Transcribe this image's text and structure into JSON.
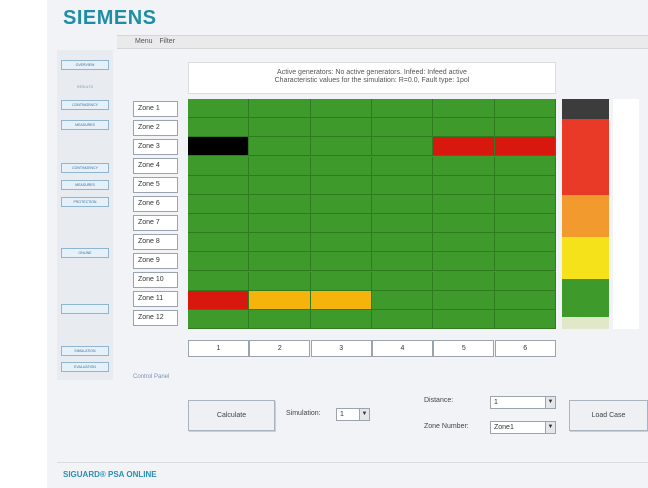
{
  "brand": {
    "logo": "SIEMENS",
    "footer": "SIGUARD® PSA ONLINE"
  },
  "menu": {
    "items": [
      "Menu",
      "Filter"
    ]
  },
  "sidebar": {
    "items": [
      {
        "label": "OVERVIEW",
        "kind": "button"
      },
      {
        "label": "RESULTS",
        "kind": "label"
      },
      {
        "label": "CONTINGENCY",
        "kind": "button"
      },
      {
        "label": "MEASURES",
        "kind": "button"
      },
      {
        "label": "",
        "kind": "label"
      },
      {
        "label": "CONTINGENCY",
        "kind": "button"
      },
      {
        "label": "MEASURES",
        "kind": "button"
      },
      {
        "label": "PROTECTION",
        "kind": "button"
      },
      {
        "label": "",
        "kind": "label"
      },
      {
        "label": "",
        "kind": "label"
      },
      {
        "label": "ONLINE",
        "kind": "button"
      },
      {
        "label": "",
        "kind": "label"
      },
      {
        "label": "",
        "kind": "label"
      },
      {
        "label": "",
        "kind": "label"
      },
      {
        "label": "",
        "kind": "button"
      },
      {
        "label": "",
        "kind": "label"
      },
      {
        "label": "SIMULATION",
        "kind": "button"
      },
      {
        "label": "EVALUATION",
        "kind": "button"
      }
    ]
  },
  "info": {
    "line1": "Active generators: No active generators.  Infeed: Infeed active",
    "line2": "Characteristic values for the simulation: R=0.0, Fault type: 1pol"
  },
  "zones": [
    "Zone 1",
    "Zone 2",
    "Zone 3",
    "Zone 4",
    "Zone 5",
    "Zone 6",
    "Zone 7",
    "Zone 8",
    "Zone 9",
    "Zone 10",
    "Zone 11",
    "Zone 12"
  ],
  "columns": [
    "1",
    "2",
    "3",
    "4",
    "5",
    "6"
  ],
  "grid_colors": {
    "green": "#3f9a2c",
    "black": "#000000",
    "red": "#d8170f",
    "amber": "#f5b40c"
  },
  "grid": [
    [
      "green",
      "green",
      "green",
      "green",
      "green",
      "green"
    ],
    [
      "green",
      "green",
      "green",
      "green",
      "green",
      "green"
    ],
    [
      "black",
      "green",
      "green",
      "green",
      "red",
      "red"
    ],
    [
      "green",
      "green",
      "green",
      "green",
      "green",
      "green"
    ],
    [
      "green",
      "green",
      "green",
      "green",
      "green",
      "green"
    ],
    [
      "green",
      "green",
      "green",
      "green",
      "green",
      "green"
    ],
    [
      "green",
      "green",
      "green",
      "green",
      "green",
      "green"
    ],
    [
      "green",
      "green",
      "green",
      "green",
      "green",
      "green"
    ],
    [
      "green",
      "green",
      "green",
      "green",
      "green",
      "green"
    ],
    [
      "green",
      "green",
      "green",
      "green",
      "green",
      "green"
    ],
    [
      "red",
      "amber",
      "amber",
      "green",
      "green",
      "green"
    ],
    [
      "green",
      "green",
      "green",
      "green",
      "green",
      "green"
    ]
  ],
  "legend": {
    "colors": [
      "#3c3c3c",
      "#e83a26",
      "#f39a2f",
      "#f5e21a",
      "#3f9a2c",
      "#dfe8c9"
    ]
  },
  "control_panel": {
    "title": "Control Panel",
    "calculate_label": "Calculate",
    "simulation_label": "Simulation:",
    "simulation_value": "1",
    "distance_label": "Distance:",
    "distance_value": "1",
    "zone_number_label": "Zone Number:",
    "zone_number_value": "Zone1",
    "load_case_label": "Load Case"
  }
}
